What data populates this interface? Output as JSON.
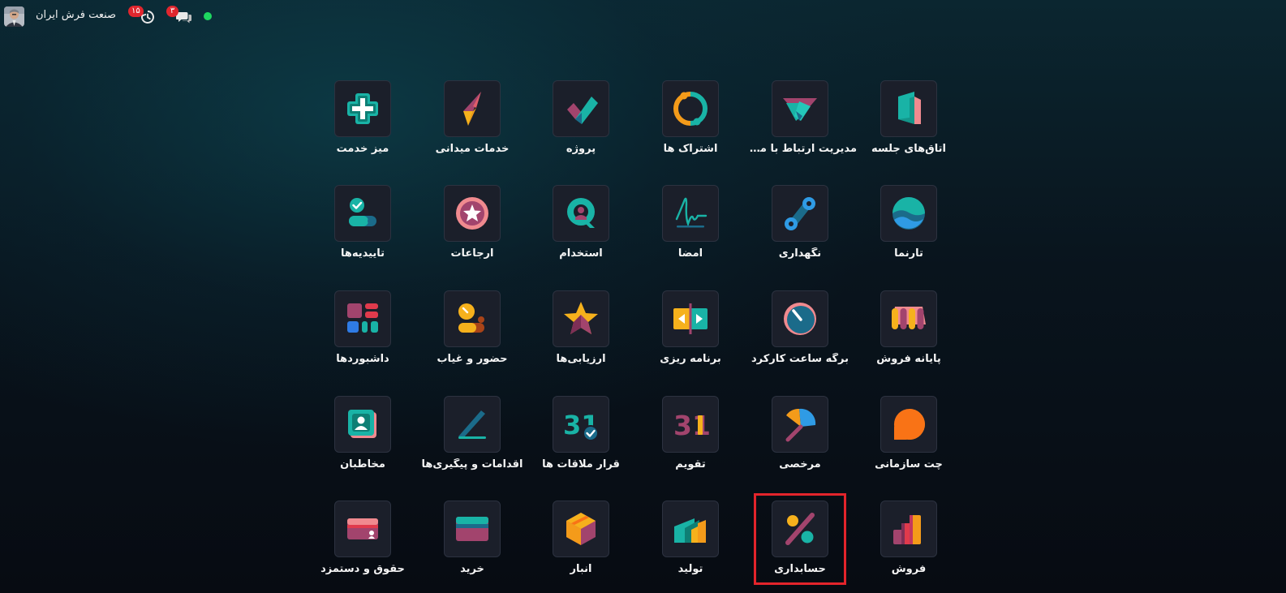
{
  "topbar": {
    "company_name": "صنعت فرش ایران",
    "activity_count": "۱۵",
    "messages_count": "۳",
    "presence_color": "#1ed760",
    "icons": [
      "user-avatar",
      "activity-clock-icon",
      "messaging-chat-icon",
      "presence-status-dot"
    ]
  },
  "apps": [
    {
      "label": "میز خدمت",
      "icon": "helpdesk-icon"
    },
    {
      "label": "خدمات میدانی",
      "icon": "field-service-icon"
    },
    {
      "label": "پروژه",
      "icon": "project-icon"
    },
    {
      "label": "اشتراک ها",
      "icon": "subscriptions-icon"
    },
    {
      "label": "مدیریت ارتباط با مشتری",
      "icon": "crm-icon"
    },
    {
      "label": "اتاق‌های جلسه",
      "icon": "meeting-rooms-icon"
    },
    {
      "label": "تاییدیه‌ها",
      "icon": "approvals-icon"
    },
    {
      "label": "ارجاعات",
      "icon": "referrals-icon"
    },
    {
      "label": "استخدام",
      "icon": "recruitment-icon"
    },
    {
      "label": "امضا",
      "icon": "sign-icon"
    },
    {
      "label": "نگهداری",
      "icon": "maintenance-icon"
    },
    {
      "label": "تارنما",
      "icon": "website-icon"
    },
    {
      "label": "داشبوردها",
      "icon": "dashboards-icon"
    },
    {
      "label": "حضور و غیاب",
      "icon": "attendances-icon"
    },
    {
      "label": "ارزیابی‌ها",
      "icon": "appraisals-icon"
    },
    {
      "label": "برنامه ریزی",
      "icon": "planning-icon"
    },
    {
      "label": "برگه ساعت کارکرد",
      "icon": "timesheets-icon"
    },
    {
      "label": "پایانه فروش",
      "icon": "point-of-sale-icon"
    },
    {
      "label": "مخاطبان",
      "icon": "contacts-icon"
    },
    {
      "label": "اقدامات و پیگیری‌ها",
      "icon": "to-do-icon"
    },
    {
      "label": "قرار ملاقات ها",
      "icon": "appointments-icon"
    },
    {
      "label": "تقویم",
      "icon": "calendar-icon"
    },
    {
      "label": "مرخصی",
      "icon": "time-off-icon"
    },
    {
      "label": "چت سازمانی",
      "icon": "discuss-icon"
    },
    {
      "label": "حقوق و دستمزد",
      "icon": "payroll-icon"
    },
    {
      "label": "خرید",
      "icon": "purchase-icon"
    },
    {
      "label": "انبار",
      "icon": "inventory-icon"
    },
    {
      "label": "تولید",
      "icon": "manufacturing-icon"
    },
    {
      "label": "حسابداری",
      "icon": "accounting-icon"
    },
    {
      "label": "فروش",
      "icon": "sales-icon"
    }
  ],
  "calendar_day": "31",
  "highlighted_app": "حسابداری",
  "highlight_color": "#e3242b"
}
